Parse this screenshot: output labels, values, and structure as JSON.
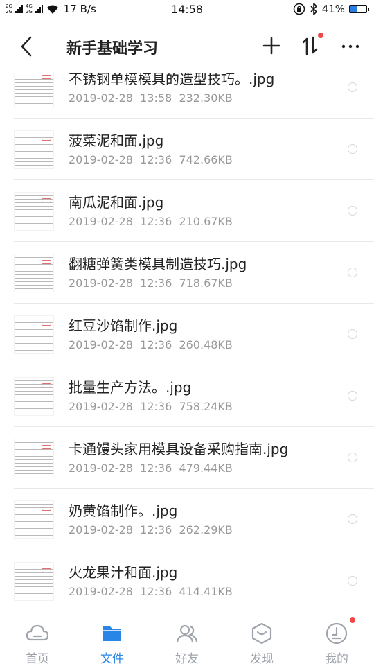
{
  "status_bar": {
    "sig1": "2G",
    "sig2": "2G",
    "net1": "4G",
    "net2": "2G",
    "speed": "17 B/s",
    "time": "14:58",
    "battery": "41%",
    "battery_level": 0.41
  },
  "header": {
    "title": "新手基础学习",
    "icons": [
      "back-icon",
      "plus-icon",
      "sort-icon",
      "more-icon"
    ],
    "sort_badge": true
  },
  "files": [
    {
      "name": "不锈钢单模模具的造型技巧。.jpg",
      "date": "2019-02-28",
      "time": "13:58",
      "size": "232.30KB"
    },
    {
      "name": "菠菜泥和面.jpg",
      "date": "2019-02-28",
      "time": "12:36",
      "size": "742.66KB"
    },
    {
      "name": "南瓜泥和面.jpg",
      "date": "2019-02-28",
      "time": "12:36",
      "size": "210.67KB"
    },
    {
      "name": "翻糖弹簧类模具制造技巧.jpg",
      "date": "2019-02-28",
      "time": "12:36",
      "size": "718.67KB"
    },
    {
      "name": "红豆沙馅制作.jpg",
      "date": "2019-02-28",
      "time": "12:36",
      "size": "260.48KB"
    },
    {
      "name": "批量生产方法。.jpg",
      "date": "2019-02-28",
      "time": "12:36",
      "size": "758.24KB"
    },
    {
      "name": "卡通馒头家用模具设备采购指南.jpg",
      "date": "2019-02-28",
      "time": "12:36",
      "size": "479.44KB"
    },
    {
      "name": "奶黄馅制作。.jpg",
      "date": "2019-02-28",
      "time": "12:36",
      "size": "262.29KB"
    },
    {
      "name": "火龙果汁和面.jpg",
      "date": "2019-02-28",
      "time": "12:36",
      "size": "414.41KB"
    }
  ],
  "bottom_nav": [
    {
      "label": "首页",
      "icon": "cloud-icon",
      "active": false
    },
    {
      "label": "文件",
      "icon": "folder-icon",
      "active": true
    },
    {
      "label": "好友",
      "icon": "friends-icon",
      "active": false
    },
    {
      "label": "发现",
      "icon": "discover-icon",
      "active": false
    },
    {
      "label": "我的",
      "icon": "profile-icon",
      "active": false,
      "badge": true
    }
  ],
  "colors": {
    "accent": "#2a86e6",
    "inactive": "#a0a5ad",
    "badge": "#f04848",
    "meta_text": "#999999"
  }
}
